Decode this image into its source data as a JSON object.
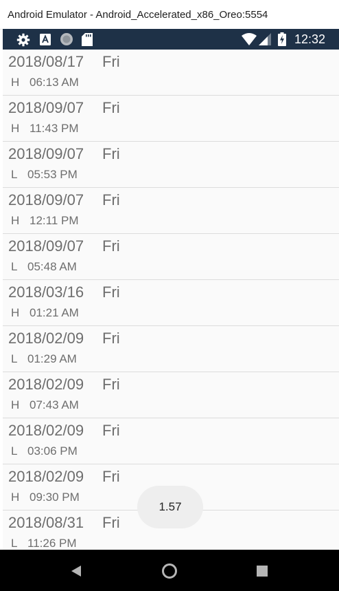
{
  "window": {
    "title": "Android Emulator - Android_Accelerated_x86_Oreo:5554"
  },
  "status_bar": {
    "left_icons": [
      "settings-gear-icon",
      "font-a-icon",
      "sync-circle-icon",
      "sd-card-icon"
    ],
    "right_icons": [
      "wifi-icon",
      "cell-signal-icon",
      "battery-charging-icon"
    ],
    "time": "12:32"
  },
  "list": {
    "items": [
      {
        "date": "2018/08/17",
        "day": "Fri",
        "type": "H",
        "time": "06:13 AM"
      },
      {
        "date": "2018/09/07",
        "day": "Fri",
        "type": "H",
        "time": "11:43 PM"
      },
      {
        "date": "2018/09/07",
        "day": "Fri",
        "type": "L",
        "time": "05:53 PM"
      },
      {
        "date": "2018/09/07",
        "day": "Fri",
        "type": "H",
        "time": "12:11 PM"
      },
      {
        "date": "2018/09/07",
        "day": "Fri",
        "type": "L",
        "time": "05:48 AM"
      },
      {
        "date": "2018/03/16",
        "day": "Fri",
        "type": "H",
        "time": "01:21 AM"
      },
      {
        "date": "2018/02/09",
        "day": "Fri",
        "type": "L",
        "time": "01:29 AM"
      },
      {
        "date": "2018/02/09",
        "day": "Fri",
        "type": "H",
        "time": "07:43 AM"
      },
      {
        "date": "2018/02/09",
        "day": "Fri",
        "type": "L",
        "time": "03:06 PM"
      },
      {
        "date": "2018/02/09",
        "day": "Fri",
        "type": "H",
        "time": "09:30 PM"
      },
      {
        "date": "2018/08/31",
        "day": "Fri",
        "type": "L",
        "time": "11:26 PM"
      }
    ]
  },
  "toast": {
    "text": "1.57"
  },
  "nav_bar": {
    "buttons": [
      "back-icon",
      "home-icon",
      "recents-icon"
    ]
  },
  "colors": {
    "status_bar": "#1e3147",
    "list_background": "#fafafa",
    "list_text": "#6e6e6e",
    "divider": "#dcdcdc",
    "toast_background": "#eeeeee",
    "nav_bar": "#000000"
  }
}
